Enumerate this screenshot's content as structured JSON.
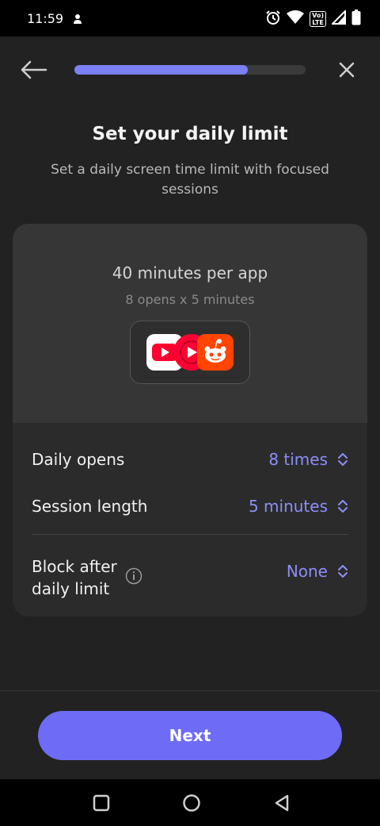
{
  "status_bar": {
    "time": "11:59",
    "network_badge_top": "Vo)",
    "network_badge_bottom": "LTE"
  },
  "header": {
    "progress_fraction": 0.75,
    "back_icon": "arrow-left-icon",
    "close_icon": "close-icon"
  },
  "page": {
    "title": "Set your daily limit",
    "subtitle": "Set a daily screen time limit with focused sessions"
  },
  "summary": {
    "main": "40 minutes per app",
    "detail": "8 opens x 5 minutes",
    "apps": [
      "youtube-icon",
      "youtube-music-icon",
      "reddit-icon"
    ]
  },
  "settings": {
    "daily_opens": {
      "label": "Daily opens",
      "value": "8 times"
    },
    "session_length": {
      "label": "Session length",
      "value": "5 minutes"
    },
    "block_after": {
      "label_line1": "Block after",
      "label_line2": "daily limit",
      "value": "None"
    }
  },
  "footer": {
    "next_label": "Next"
  },
  "colors": {
    "accent": "#7b80f5",
    "button": "#6e6cf6",
    "background": "#222222",
    "card": "#2b2b2b"
  }
}
